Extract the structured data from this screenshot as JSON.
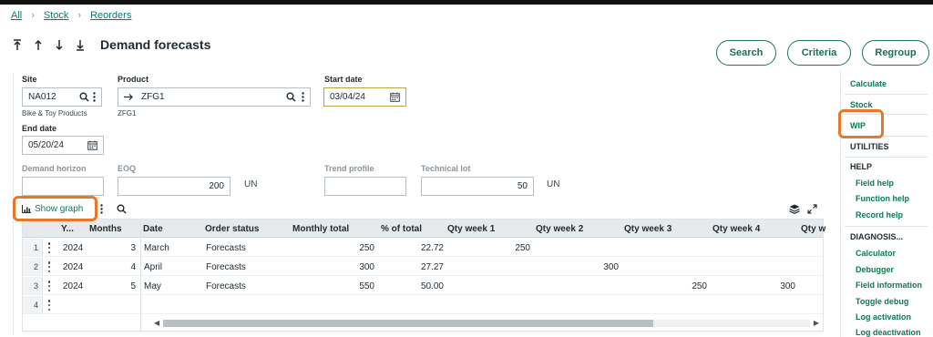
{
  "breadcrumb": {
    "items": [
      "All",
      "Stock",
      "Reorders"
    ]
  },
  "page": {
    "title": "Demand forecasts"
  },
  "actions": {
    "search": "Search",
    "criteria": "Criteria",
    "regroup": "Regroup"
  },
  "form": {
    "site": {
      "label": "Site",
      "value": "NA012",
      "description": "Bike & Toy Products"
    },
    "product": {
      "label": "Product",
      "value": "ZFG1",
      "description": "ZFG1"
    },
    "start_date": {
      "label": "Start date",
      "value": "03/04/24"
    },
    "end_date": {
      "label": "End date",
      "value": "05/20/24"
    },
    "demand_horizon": {
      "label": "Demand horizon",
      "value": ""
    },
    "eoq": {
      "label": "EOQ",
      "value": "200",
      "unit": "UN"
    },
    "trend_profile": {
      "label": "Trend profile",
      "value": ""
    },
    "technical_lot": {
      "label": "Technical lot",
      "value": "50",
      "unit": "UN"
    }
  },
  "grid_toolbar": {
    "show_graph": "Show graph"
  },
  "grid": {
    "columns": [
      "Y...",
      "Months",
      "Date",
      "Order status",
      "Monthly total",
      "% of total",
      "Qty week 1",
      "Qty week 2",
      "Qty week 3",
      "Qty week 4",
      "Qty w"
    ],
    "rows": [
      {
        "num": "1",
        "year": "2024",
        "months": "3",
        "date": "March",
        "status": "Forecasts",
        "monthly_total": "250",
        "pct": "22.72",
        "w1": "250",
        "w2": "",
        "w3": "",
        "w4": ""
      },
      {
        "num": "2",
        "year": "2024",
        "months": "4",
        "date": "April",
        "status": "Forecasts",
        "monthly_total": "300",
        "pct": "27.27",
        "w1": "",
        "w2": "300",
        "w3": "",
        "w4": ""
      },
      {
        "num": "3",
        "year": "2024",
        "months": "5",
        "date": "May",
        "status": "Forecasts",
        "monthly_total": "550",
        "pct": "50.00",
        "w1": "",
        "w2": "",
        "w3": "250",
        "w4": "300"
      },
      {
        "num": "4",
        "year": "",
        "months": "",
        "date": "",
        "status": "",
        "monthly_total": "",
        "pct": "",
        "w1": "",
        "w2": "",
        "w3": "",
        "w4": ""
      }
    ]
  },
  "sidebar": {
    "calculate": "Calculate",
    "stock": "Stock",
    "wip": "WIP",
    "utilities": "UTILITIES",
    "help_head": "HELP",
    "field_help": "Field help",
    "function_help": "Function help",
    "record_help": "Record help",
    "diagnosis_head": "DIAGNOSIS...",
    "calculator": "Calculator",
    "debugger": "Debugger",
    "field_information": "Field information",
    "toggle_debug": "Toggle debug",
    "log_activation": "Log activation",
    "log_deactivation": "Log deactivation"
  },
  "colors": {
    "accent": "#0c7a4e",
    "highlight": "#e8762b",
    "focus": "#b8a24a"
  }
}
